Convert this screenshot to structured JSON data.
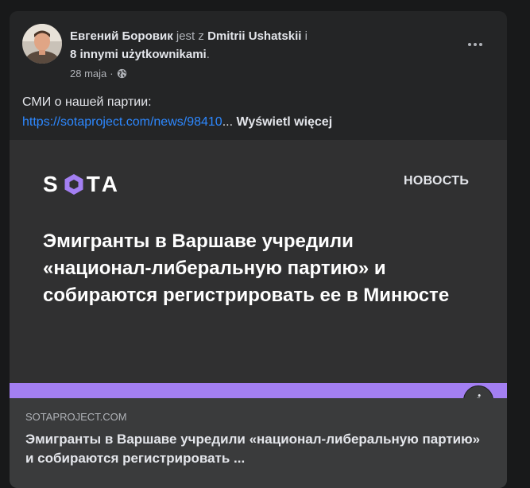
{
  "post": {
    "author": "Евгений Боровик",
    "with_text": " jest z ",
    "tagged": "Dmitrii Ushatskii",
    "and_text": " i",
    "others": "8 innymi użytkownikami",
    "period": ".",
    "date": "28 maja",
    "separator": "·",
    "privacy_icon": "globe-icon",
    "text_line1": "СМИ о нашей партии:",
    "link_text": "https://sotaproject.com/news/98410",
    "ellipsis": "...",
    "see_more": "Wyświetl więcej"
  },
  "preview": {
    "logo_left": "S",
    "logo_right": "TA",
    "news_label": "НОВОСТЬ",
    "headline": "Эмигранты в Варшаве учредили «национал-либеральную партию» и собираются регистрировать ее в Минюсте",
    "accent_color": "#a37ff2"
  },
  "link": {
    "domain": "SOTAPROJECT.COM",
    "title": "Эмигранты в Варшаве учредили «национал-либеральную партию» и собираются регистрировать ..."
  },
  "colors": {
    "background": "#18191a",
    "card": "#242526",
    "link": "#2d88ff"
  }
}
